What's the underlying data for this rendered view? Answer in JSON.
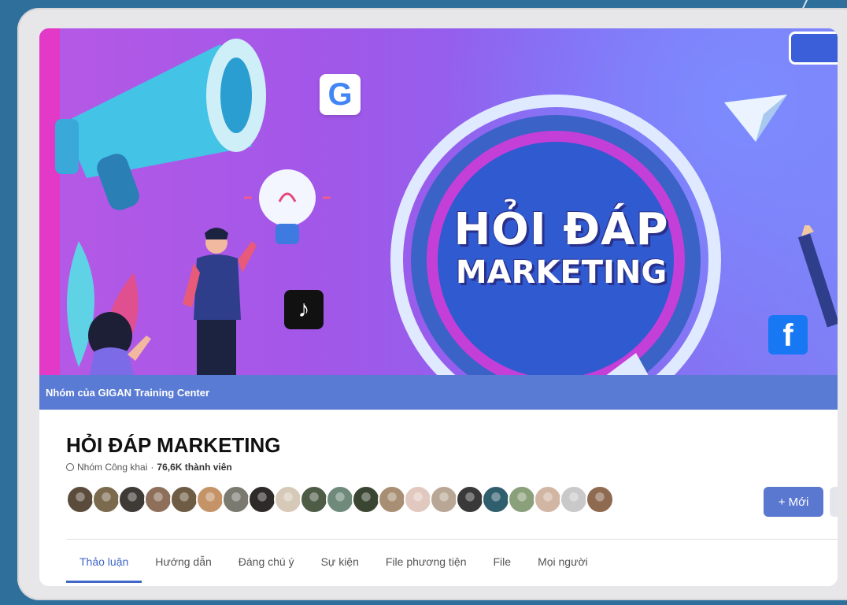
{
  "cover": {
    "title_line1": "HỎI ĐÁP",
    "title_line2": "MARKETING",
    "badges": {
      "google": "G",
      "tiktok": "♪",
      "facebook": "f"
    },
    "colors": {
      "cover_left": "#b659e6",
      "cover_right": "#7f7ef5",
      "accent_pink": "#e23ac6"
    }
  },
  "group_bar": {
    "label": "Nhóm của GIGAN Training Center"
  },
  "group": {
    "name": "HỎI ĐÁP MARKETING",
    "privacy": "Nhóm Công khai",
    "separator": "·",
    "members": "76,6K thành viên",
    "avatar_colors": [
      "#5b4b3b",
      "#7b6a4e",
      "#3e3a36",
      "#8d6f5a",
      "#6e5c44",
      "#c49468",
      "#7a7a70",
      "#2d2a28",
      "#d7c9b8",
      "#4e5c46",
      "#6f8a7a",
      "#3b4632",
      "#a88f73",
      "#e1c9c0",
      "#b9a796",
      "#393939",
      "#2f5e6c",
      "#8aa07a",
      "#d2b6a4",
      "#c9c9c9",
      "#8e6a50"
    ]
  },
  "actions": {
    "new_button": "+ Mới"
  },
  "tabs": [
    {
      "label": "Thảo luận",
      "active": true
    },
    {
      "label": "Hướng dẫn",
      "active": false
    },
    {
      "label": "Đáng chú ý",
      "active": false
    },
    {
      "label": "Sự kiện",
      "active": false
    },
    {
      "label": "File phương tiện",
      "active": false
    },
    {
      "label": "File",
      "active": false
    },
    {
      "label": "Mọi người",
      "active": false
    }
  ]
}
